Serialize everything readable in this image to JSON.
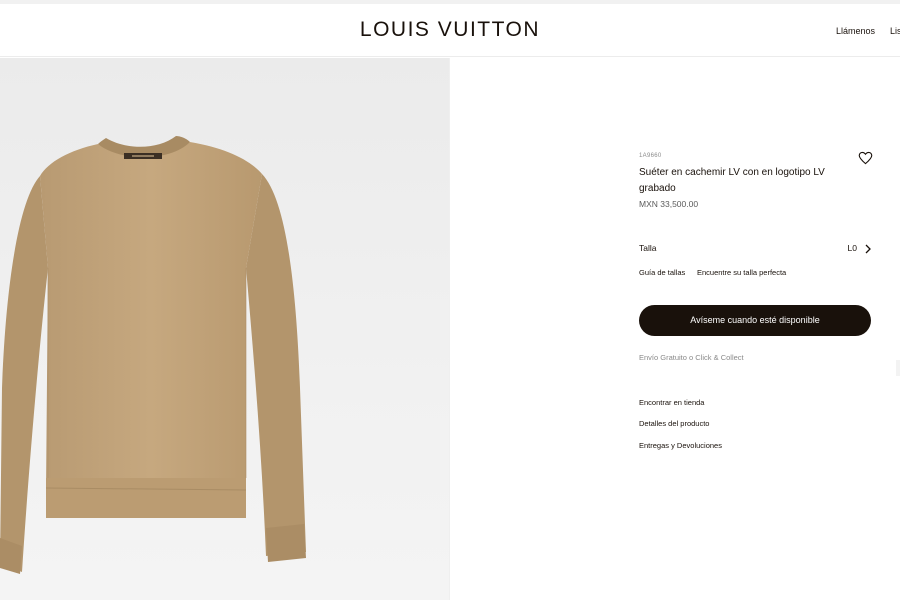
{
  "header": {
    "brand": "LOUIS VUITTON",
    "nav_call": "Llámenos",
    "nav_list": "Lis"
  },
  "product": {
    "image_alt": "Suéter en cachemir LV con en logotipo LV grabado",
    "reference": "1A9660",
    "title": "Suéter en cachemir LV con en logotipo LV grabado",
    "price": "MXN 33,500.00",
    "wishlist_icon": "heart-icon",
    "sweater_color": "#c4a57e"
  },
  "size": {
    "label": "Talla",
    "value": "L0",
    "chevron_icon": "chevron-right-icon"
  },
  "guide": {
    "link": "Guía de tallas",
    "hint": "Encuentre su talla perfecta"
  },
  "cta": {
    "notify": "Avíseme cuando esté disponible"
  },
  "shipping": "Envío Gratuito o Click & Collect",
  "links": [
    "Encontrar en tienda",
    "Detalles del producto",
    "Entregas y Devoluciones"
  ],
  "colors": {
    "primary": "#19110b",
    "muted": "#8a8a8a",
    "background": "#ffffff"
  }
}
